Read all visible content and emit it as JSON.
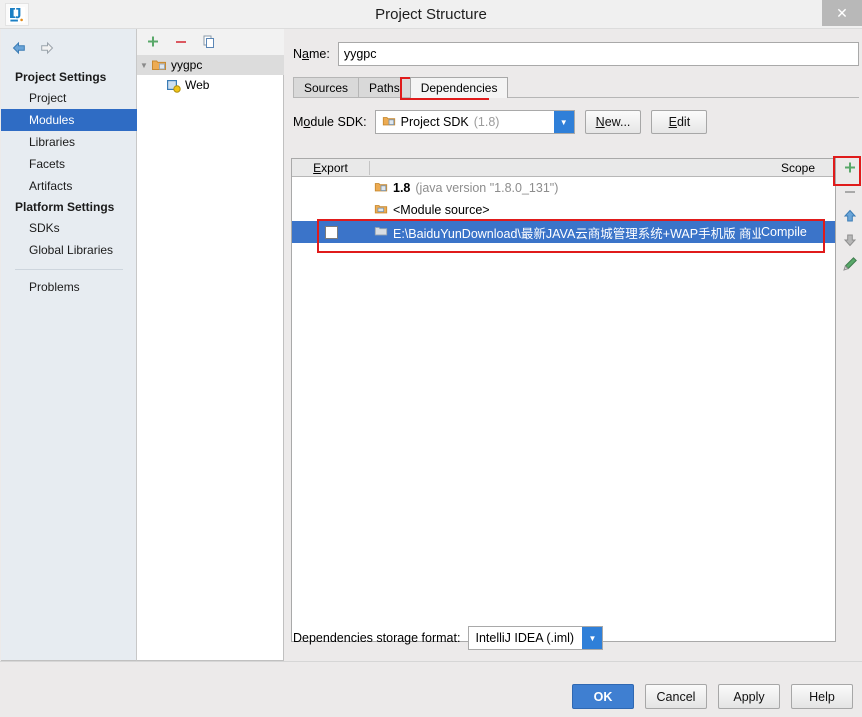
{
  "window": {
    "title": "Project Structure",
    "logo_icon": "intellij-idea-logo",
    "close_icon": "close-icon"
  },
  "sidebar": {
    "back_icon": "back-arrow-icon",
    "forward_icon": "forward-arrow-icon",
    "groups": [
      {
        "title": "Project Settings",
        "items": [
          {
            "label": "Project",
            "selected": false
          },
          {
            "label": "Modules",
            "selected": true
          },
          {
            "label": "Libraries",
            "selected": false
          },
          {
            "label": "Facets",
            "selected": false
          },
          {
            "label": "Artifacts",
            "selected": false
          }
        ]
      },
      {
        "title": "Platform Settings",
        "items": [
          {
            "label": "SDKs",
            "selected": false
          },
          {
            "label": "Global Libraries",
            "selected": false
          }
        ]
      }
    ],
    "problems_label": "Problems"
  },
  "module_tree": {
    "toolbar": [
      {
        "icon": "add-module-icon",
        "label": "+"
      },
      {
        "icon": "remove-module-icon",
        "label": "−"
      },
      {
        "icon": "copy-module-icon",
        "label": "copy"
      }
    ],
    "nodes": [
      {
        "label": "yygpc",
        "icon": "module-folder-icon",
        "selected": true,
        "expanded": true,
        "level": 0
      },
      {
        "label": "Web",
        "icon": "web-facet-icon",
        "selected": false,
        "expanded": false,
        "level": 1
      }
    ]
  },
  "main": {
    "name_label": "Name:",
    "name_value": "yygpc",
    "name_placeholder": "",
    "tabs": [
      {
        "label": "Sources",
        "active": false
      },
      {
        "label": "Paths",
        "active": false
      },
      {
        "label": "Dependencies",
        "active": true
      }
    ],
    "sdk": {
      "label": "Module SDK:",
      "value": "Project SDK",
      "value_suffix": "(1.8)",
      "icon": "sdk-folder-icon",
      "dropdown_icon": "chevron-down-icon",
      "new_button": "New...",
      "edit_button": "Edit"
    },
    "table": {
      "columns": [
        "Export",
        "",
        "Scope"
      ],
      "rows": [
        {
          "export_checkbox": null,
          "icon": "jdk-icon",
          "name": "1.8",
          "detail": "(java version \"1.8.0_131\")",
          "scope": "",
          "selected": false
        },
        {
          "export_checkbox": null,
          "icon": "module-source-icon",
          "name": "<Module source>",
          "detail": "",
          "scope": "",
          "selected": false
        },
        {
          "export_checkbox": false,
          "icon": "library-folder-icon",
          "name": "E:\\BaiduYunDownload\\最新JAVA云商城管理系统+WAP手机版 商业",
          "detail": "",
          "scope": "Compile",
          "selected": true
        }
      ]
    },
    "side_toolbar": [
      {
        "icon": "add-dependency-icon",
        "name": "add"
      },
      {
        "icon": "remove-dependency-icon",
        "name": "remove"
      },
      {
        "icon": "move-up-icon",
        "name": "move-up"
      },
      {
        "icon": "move-down-icon",
        "name": "move-down"
      },
      {
        "icon": "edit-dependency-icon",
        "name": "edit"
      }
    ],
    "storage": {
      "label": "Dependencies storage format:",
      "value": "IntelliJ IDEA (.iml)",
      "dropdown_icon": "chevron-down-icon"
    }
  },
  "footer": {
    "buttons": [
      {
        "label": "OK",
        "primary": true
      },
      {
        "label": "Cancel",
        "primary": false
      },
      {
        "label": "Apply",
        "primary": false
      },
      {
        "label": "Help",
        "primary": false
      }
    ]
  },
  "annotations": {
    "color": "#e01b1b",
    "boxes": [
      "dependencies-tab",
      "add-dependency-button",
      "selected-dependency-row"
    ]
  }
}
